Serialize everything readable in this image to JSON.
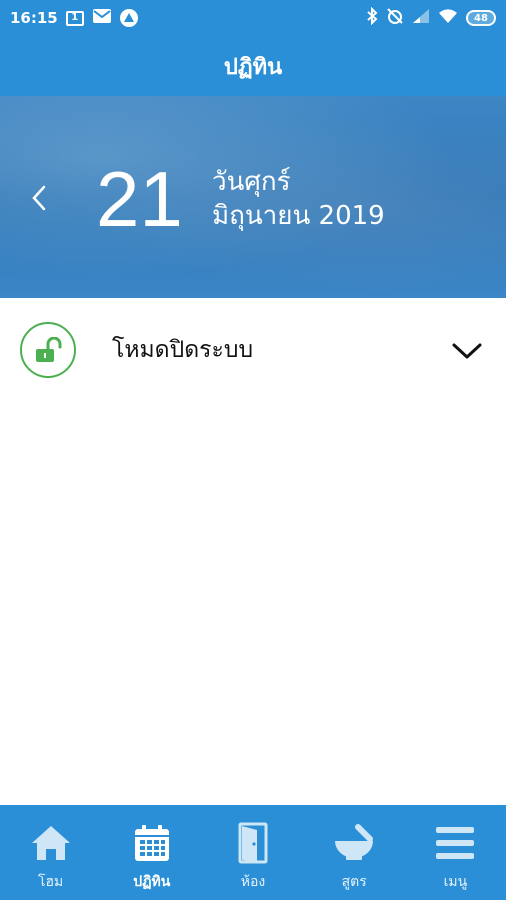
{
  "status": {
    "time": "16:15",
    "notif_box": "1",
    "battery": "48"
  },
  "header": {
    "title": "ปฏิทิน"
  },
  "hero": {
    "day": "21",
    "weekday": "วันศุกร์",
    "month_year": "มิถุนายน 2019"
  },
  "mode": {
    "label": "โหมดปิดระบบ"
  },
  "bottom_nav": {
    "items": [
      {
        "label": "โฮม",
        "icon": "home-icon",
        "active": false
      },
      {
        "label": "ปฏิทิน",
        "icon": "calendar-icon",
        "active": true
      },
      {
        "label": "ห้อง",
        "icon": "door-icon",
        "active": false
      },
      {
        "label": "สูตร",
        "icon": "mortar-pestle-icon",
        "active": false
      },
      {
        "label": "เมนู",
        "icon": "hamburger-icon",
        "active": false
      }
    ]
  },
  "colors": {
    "primary": "#2a8fd6",
    "lock_green": "#4caf50"
  }
}
